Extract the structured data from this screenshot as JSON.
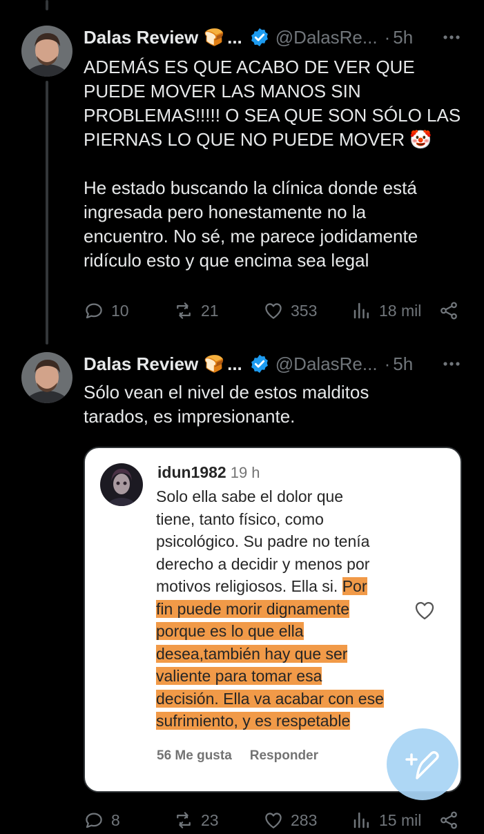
{
  "tweets": [
    {
      "author": "Dalas Review",
      "name_emoji": "🍞",
      "ellipsis": "...",
      "handle": "@DalasRe...",
      "dot": "·",
      "time": "5h",
      "text_lines": [
        "ADEMÁS ES QUE ACABO DE VER QUE",
        "PUEDE MOVER LAS MANOS SIN",
        "PROBLEMAS!!!!! O SEA QUE SON SÓLO LAS",
        "PIERNAS LO QUE NO PUEDE MOVER 🤡"
      ],
      "text_lines_2": [
        "He estado buscando la clínica donde está",
        "ingresada pero honestamente no la",
        "encuentro. No sé, me parece jodidamente",
        "ridículo esto y que encima sea legal"
      ],
      "replies": "10",
      "retweets": "21",
      "likes": "353",
      "views": "18 mil"
    },
    {
      "author": "Dalas Review",
      "name_emoji": "🍞",
      "ellipsis": "...",
      "handle": "@DalasRe...",
      "dot": "·",
      "time": "5h",
      "text_lines": [
        "Sólo vean el nivel de estos malditos",
        "tarados, es impresionante."
      ],
      "replies": "8",
      "retweets": "23",
      "likes": "283",
      "views": "15 mil"
    }
  ],
  "embedded_comment": {
    "username": "idun1982",
    "age": "19 h",
    "lines": [
      {
        "plain": "Solo ella sabe el dolor que",
        "hl": ""
      },
      {
        "plain": "tiene, tanto físico, como",
        "hl": ""
      },
      {
        "plain": "psicológico. Su padre no tenía",
        "hl": ""
      },
      {
        "plain": "derecho a decidir y menos por",
        "hl": ""
      },
      {
        "plain": "motivos religiosos. Ella si. ",
        "hl": "Por"
      },
      {
        "plain": "",
        "hl": "fin puede morir dignamente"
      },
      {
        "plain": "",
        "hl": "porque es lo que ella"
      },
      {
        "plain": "",
        "hl": "desea,también hay que ser"
      },
      {
        "plain": "",
        "hl": "valiente para tomar esa"
      },
      {
        "plain": "",
        "hl": "decisión. Ella va acabar con ese"
      },
      {
        "plain": "",
        "hl": "sufrimiento, y es respetable"
      }
    ],
    "likes_label": "56 Me gusta",
    "reply_label": "Responder"
  },
  "colors": {
    "background": "#000000",
    "text": "#e7e9ea",
    "muted": "#71767b",
    "verified": "#1d9bf0",
    "highlight": "#f19a48",
    "compose_fab": "#a8d4f5"
  },
  "icons": {
    "verified": "verified-badge-icon",
    "more": "more-options-icon",
    "reply": "reply-icon",
    "retweet": "retweet-icon",
    "like": "heart-icon",
    "views": "views-icon",
    "share": "share-icon",
    "compose": "compose-post-icon"
  }
}
